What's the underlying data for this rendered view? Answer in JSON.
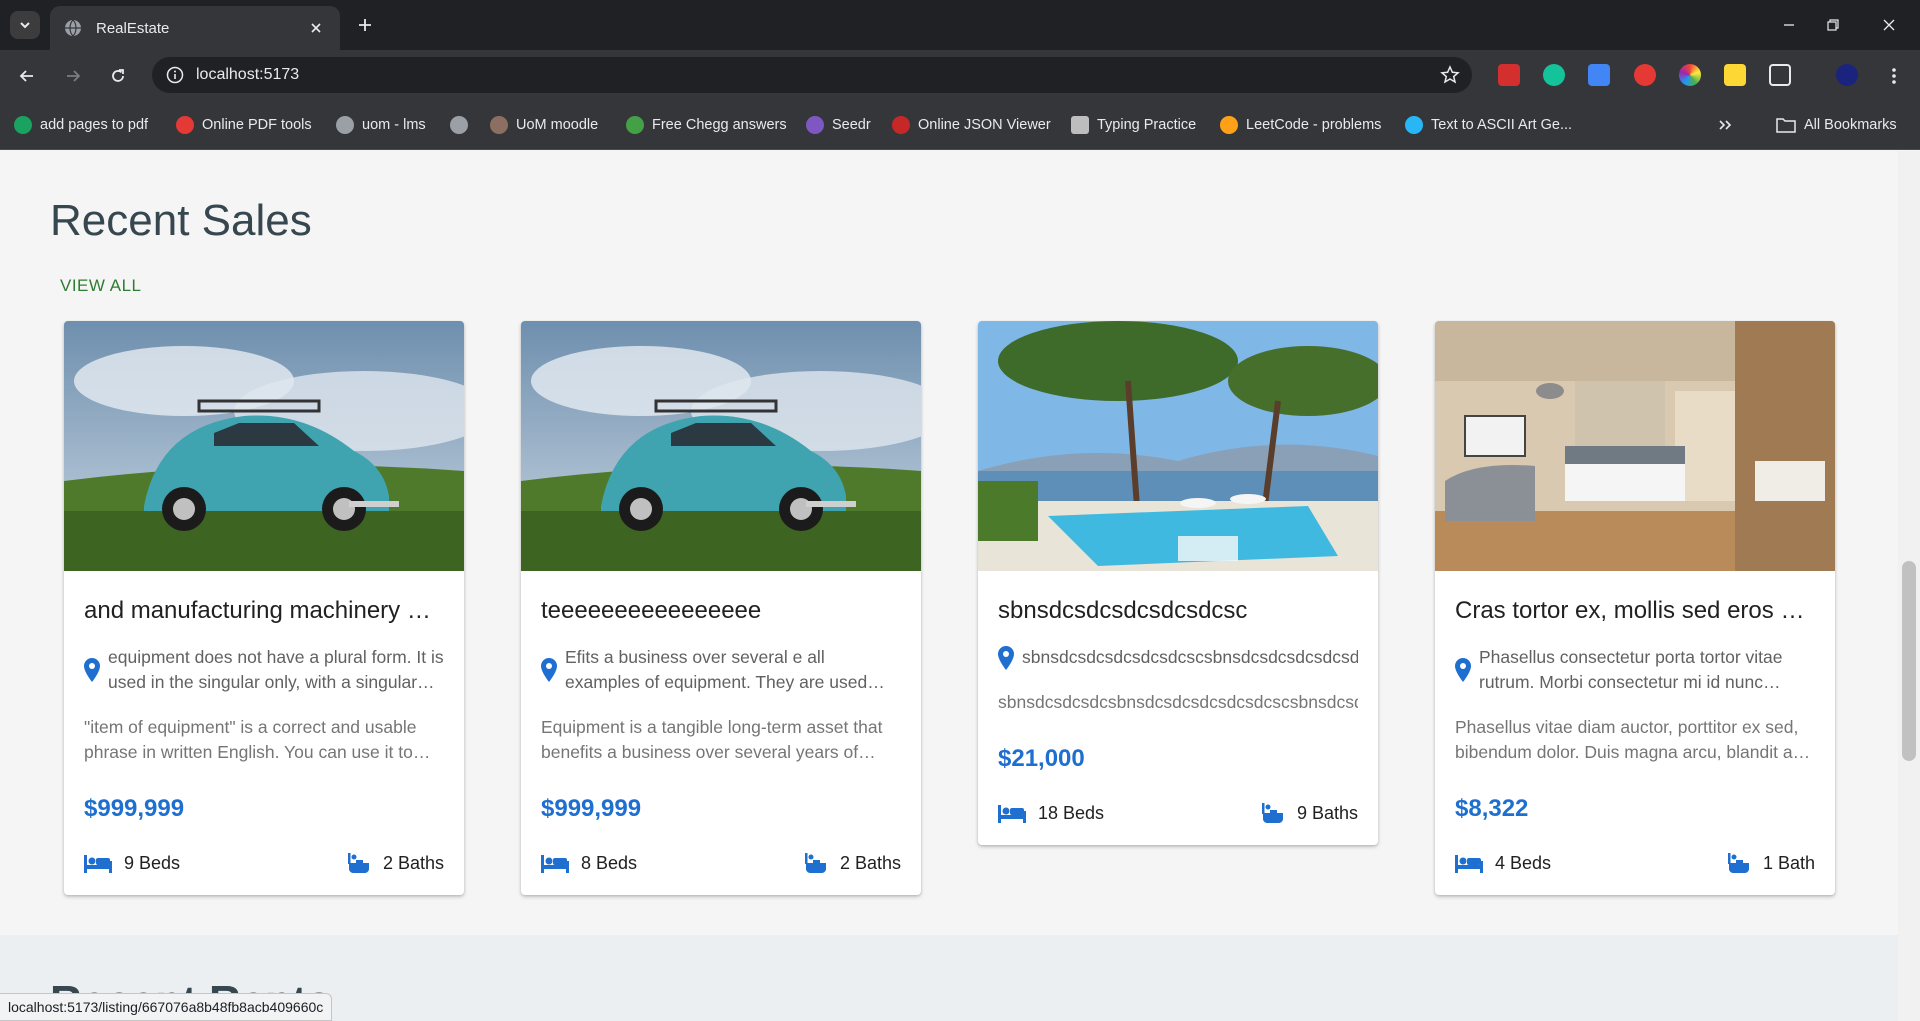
{
  "browser": {
    "tab_title": "RealEstate",
    "url": "localhost:5173",
    "bookmarks": [
      {
        "label": "add pages to pdf",
        "color": "#1aa260"
      },
      {
        "label": "Online PDF tools",
        "color": "#e53935"
      },
      {
        "label": "uom - lms",
        "color": "#9aa0a6"
      },
      {
        "label": "",
        "color": "#9aa0a6"
      },
      {
        "label": "UoM moodle",
        "color": "#8d6e63"
      },
      {
        "label": "Free Chegg answers",
        "color": "#43a047"
      },
      {
        "label": "Seedr",
        "color": "#7e57c2"
      },
      {
        "label": "Online JSON Viewer",
        "color": "#c62828"
      },
      {
        "label": "Typing Practice",
        "color": "#bdbdbd"
      },
      {
        "label": "LeetCode - problems",
        "color": "#ffa116"
      },
      {
        "label": "Text to ASCII Art Ge...",
        "color": "#29b6f6"
      }
    ],
    "all_bookmarks_label": "All Bookmarks",
    "status_url": "localhost:5173/listing/667076a8b48fb8acb409660c"
  },
  "section": {
    "title": "Recent Sales",
    "view_all": "VIEW ALL",
    "next_title": "Recent Rents"
  },
  "listings": [
    {
      "title": "and manufacturing machinery equipment",
      "address": "equipment does not have a plural form. It is used in the singular only, with a singular verb.",
      "description": "\"item of equipment\" is a correct and usable phrase in written English. You can use it to refer to a single piece.",
      "price": "$999,999",
      "beds": "9 Beds",
      "baths": "2 Baths",
      "image": "car"
    },
    {
      "title": "teeeeeeeeeeeeeeee",
      "address": "Efits a business over several e all examples of equipment. They are used daily.",
      "description": "Equipment is a tangible long-term asset that benefits a business over several years of operation.",
      "price": "$999,999",
      "beds": "8 Beds",
      "baths": "2 Baths",
      "image": "car"
    },
    {
      "title": "sbnsdcsdcsdcsdcsdcsc",
      "address": "sbnsdcsdcsdcsdcsdcscsbnsdcsdcsdcsdcsdcsc",
      "description": "sbnsdcsdcsdcsbnsdcsdcsdcsdcsdcscsbnsdcsdcsdc",
      "price": "$21,000",
      "beds": "18 Beds",
      "baths": "9 Baths",
      "image": "pool"
    },
    {
      "title": "Cras tortor ex, mollis sed eros vitae",
      "address": "Phasellus consectetur porta tortor vitae rutrum. Morbi consectetur mi id nunc lacinia.",
      "description": "Phasellus vitae diam auctor, porttitor ex sed, bibendum dolor. Duis magna arcu, blandit a tempor.",
      "price": "$8,322",
      "beds": "4 Beds",
      "baths": "1 Bath",
      "image": "room"
    }
  ],
  "colors": {
    "accent": "#1e6fd0",
    "view_all": "#2e7d32",
    "chrome_bg": "#35363a"
  }
}
